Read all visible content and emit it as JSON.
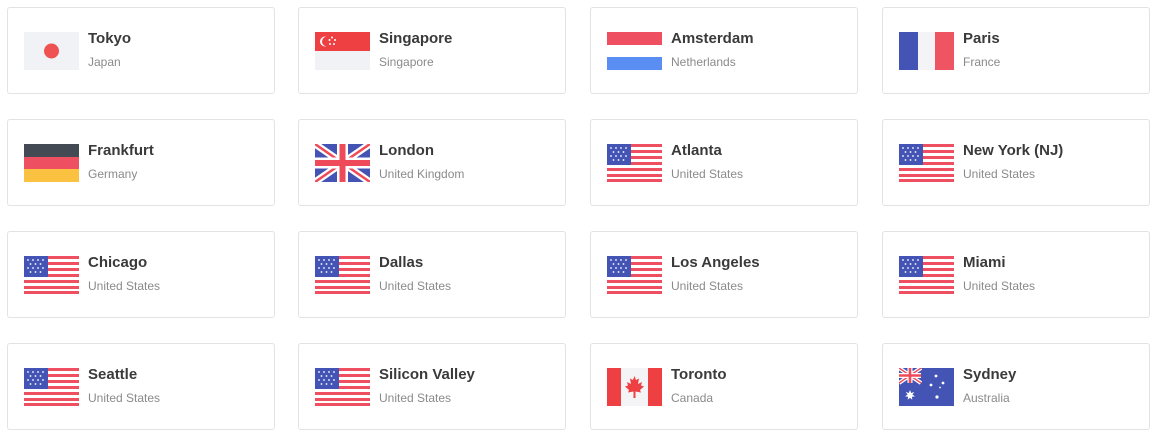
{
  "locations": [
    {
      "city": "Tokyo",
      "country": "Japan",
      "flag": "japan-flag-icon"
    },
    {
      "city": "Singapore",
      "country": "Singapore",
      "flag": "singapore-flag-icon"
    },
    {
      "city": "Amsterdam",
      "country": "Netherlands",
      "flag": "netherlands-flag-icon"
    },
    {
      "city": "Paris",
      "country": "France",
      "flag": "france-flag-icon"
    },
    {
      "city": "Frankfurt",
      "country": "Germany",
      "flag": "germany-flag-icon"
    },
    {
      "city": "London",
      "country": "United Kingdom",
      "flag": "united-kingdom-flag-icon"
    },
    {
      "city": "Atlanta",
      "country": "United States",
      "flag": "united-states-flag-icon"
    },
    {
      "city": "New York (NJ)",
      "country": "United States",
      "flag": "united-states-flag-icon"
    },
    {
      "city": "Chicago",
      "country": "United States",
      "flag": "united-states-flag-icon"
    },
    {
      "city": "Dallas",
      "country": "United States",
      "flag": "united-states-flag-icon"
    },
    {
      "city": "Los Angeles",
      "country": "United States",
      "flag": "united-states-flag-icon"
    },
    {
      "city": "Miami",
      "country": "United States",
      "flag": "united-states-flag-icon"
    },
    {
      "city": "Seattle",
      "country": "United States",
      "flag": "united-states-flag-icon"
    },
    {
      "city": "Silicon Valley",
      "country": "United States",
      "flag": "united-states-flag-icon"
    },
    {
      "city": "Toronto",
      "country": "Canada",
      "flag": "canada-flag-icon"
    },
    {
      "city": "Sydney",
      "country": "Australia",
      "flag": "australia-flag-icon"
    }
  ]
}
